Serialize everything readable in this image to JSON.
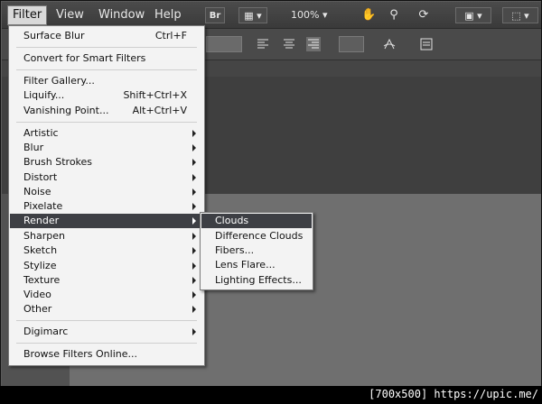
{
  "menubar": {
    "items": [
      "Filter",
      "View",
      "Window",
      "Help"
    ],
    "bridge_label": "Br",
    "zoom": "100%"
  },
  "filter_menu": {
    "items": [
      {
        "label": "Surface Blur",
        "shortcut": "Ctrl+F"
      },
      {
        "label": "Convert for Smart Filters",
        "shortcut": ""
      },
      {
        "label": "Filter Gallery...",
        "shortcut": ""
      },
      {
        "label": "Liquify...",
        "shortcut": "Shift+Ctrl+X"
      },
      {
        "label": "Vanishing Point...",
        "shortcut": "Alt+Ctrl+V"
      },
      {
        "label": "Artistic",
        "submenu": true
      },
      {
        "label": "Blur",
        "submenu": true
      },
      {
        "label": "Brush Strokes",
        "submenu": true
      },
      {
        "label": "Distort",
        "submenu": true
      },
      {
        "label": "Noise",
        "submenu": true
      },
      {
        "label": "Pixelate",
        "submenu": true
      },
      {
        "label": "Render",
        "submenu": true,
        "active": true
      },
      {
        "label": "Sharpen",
        "submenu": true
      },
      {
        "label": "Sketch",
        "submenu": true
      },
      {
        "label": "Stylize",
        "submenu": true
      },
      {
        "label": "Texture",
        "submenu": true
      },
      {
        "label": "Video",
        "submenu": true
      },
      {
        "label": "Other",
        "submenu": true
      },
      {
        "label": "Digimarc",
        "submenu": true
      },
      {
        "label": "Browse Filters Online...",
        "shortcut": ""
      }
    ]
  },
  "render_submenu": {
    "items": [
      "Clouds",
      "Difference Clouds",
      "Fibers...",
      "Lens Flare...",
      "Lighting Effects..."
    ],
    "active": "Clouds"
  },
  "watermark": "[700x500] https://upic.me/",
  "colors": {
    "menu_bg": "#f3f3f3",
    "highlight": "#3d3f44",
    "chrome": "#4a4a4a"
  }
}
